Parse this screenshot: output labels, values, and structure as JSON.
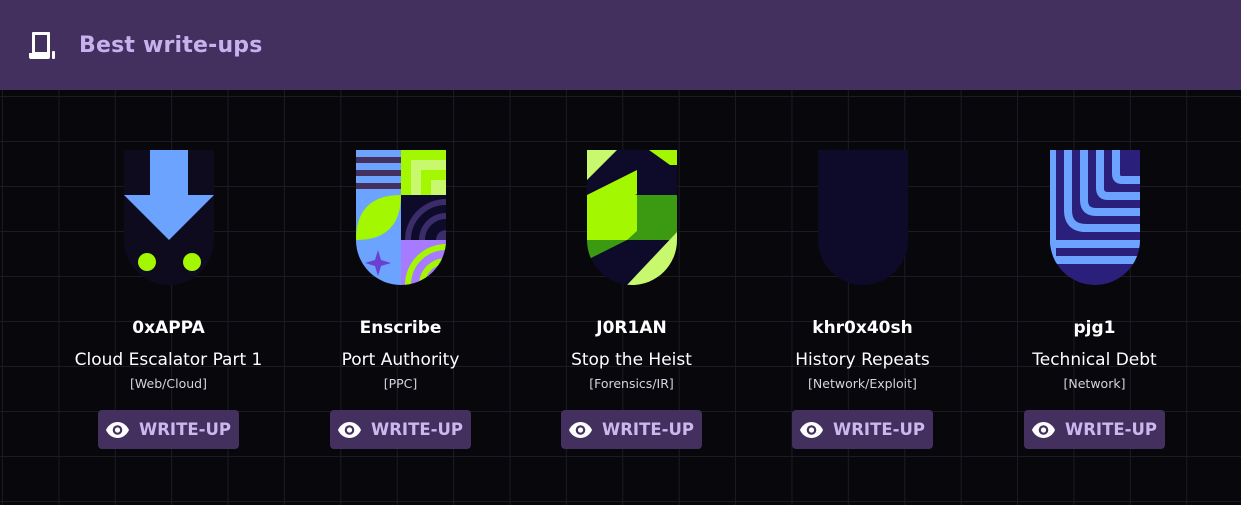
{
  "header": {
    "title": "Best write-ups",
    "icon": "document-icon"
  },
  "colors": {
    "header_bg": "#44305f",
    "accent": "#c9b1ee",
    "lime": "#a3f700",
    "blue": "#6ba3ff",
    "navy": "#0e0a2a"
  },
  "writeups": [
    {
      "author": "0xAPPA",
      "challenge": "Cloud Escalator Part 1",
      "category": "[Web/Cloud]",
      "button": "WRITE-UP",
      "badge_icon": "arrow-down-badge-icon"
    },
    {
      "author": "Enscribe",
      "challenge": "Port Authority",
      "category": "[PPC]",
      "button": "WRITE-UP",
      "badge_icon": "port-authority-badge-icon"
    },
    {
      "author": "J0R1AN",
      "challenge": "Stop the Heist",
      "category": "[Forensics/IR]",
      "button": "WRITE-UP",
      "badge_icon": "stop-heist-badge-icon"
    },
    {
      "author": "khr0x40sh",
      "challenge": "History Repeats",
      "category": "[Network/Exploit]",
      "button": "WRITE-UP",
      "badge_icon": "history-repeats-badge-icon"
    },
    {
      "author": "pjg1",
      "challenge": "Technical Debt",
      "category": "[Network]",
      "button": "WRITE-UP",
      "badge_icon": "technical-debt-badge-icon"
    }
  ]
}
